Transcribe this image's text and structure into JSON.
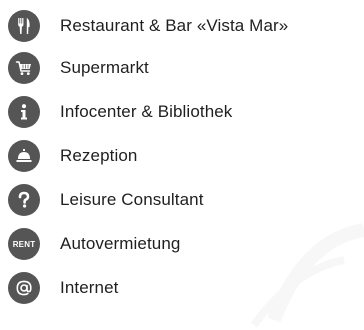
{
  "theme": {
    "icon_background": "#555555",
    "text_color": "#1f1f1f"
  },
  "legend": {
    "items": [
      {
        "icon": "fork-knife-icon",
        "label": "Restaurant & Bar «Vista Mar»"
      },
      {
        "icon": "shopping-cart-icon",
        "label": "Supermarkt"
      },
      {
        "icon": "info-icon",
        "label": "Infocenter & Bibliothek"
      },
      {
        "icon": "reception-bell-icon",
        "label": "Rezeption"
      },
      {
        "icon": "question-mark-icon",
        "label": "Leisure Consultant"
      },
      {
        "icon": "rent-icon",
        "label": "Autovermietung",
        "badge_text": "RENT"
      },
      {
        "icon": "at-sign-icon",
        "label": "Internet"
      }
    ]
  }
}
